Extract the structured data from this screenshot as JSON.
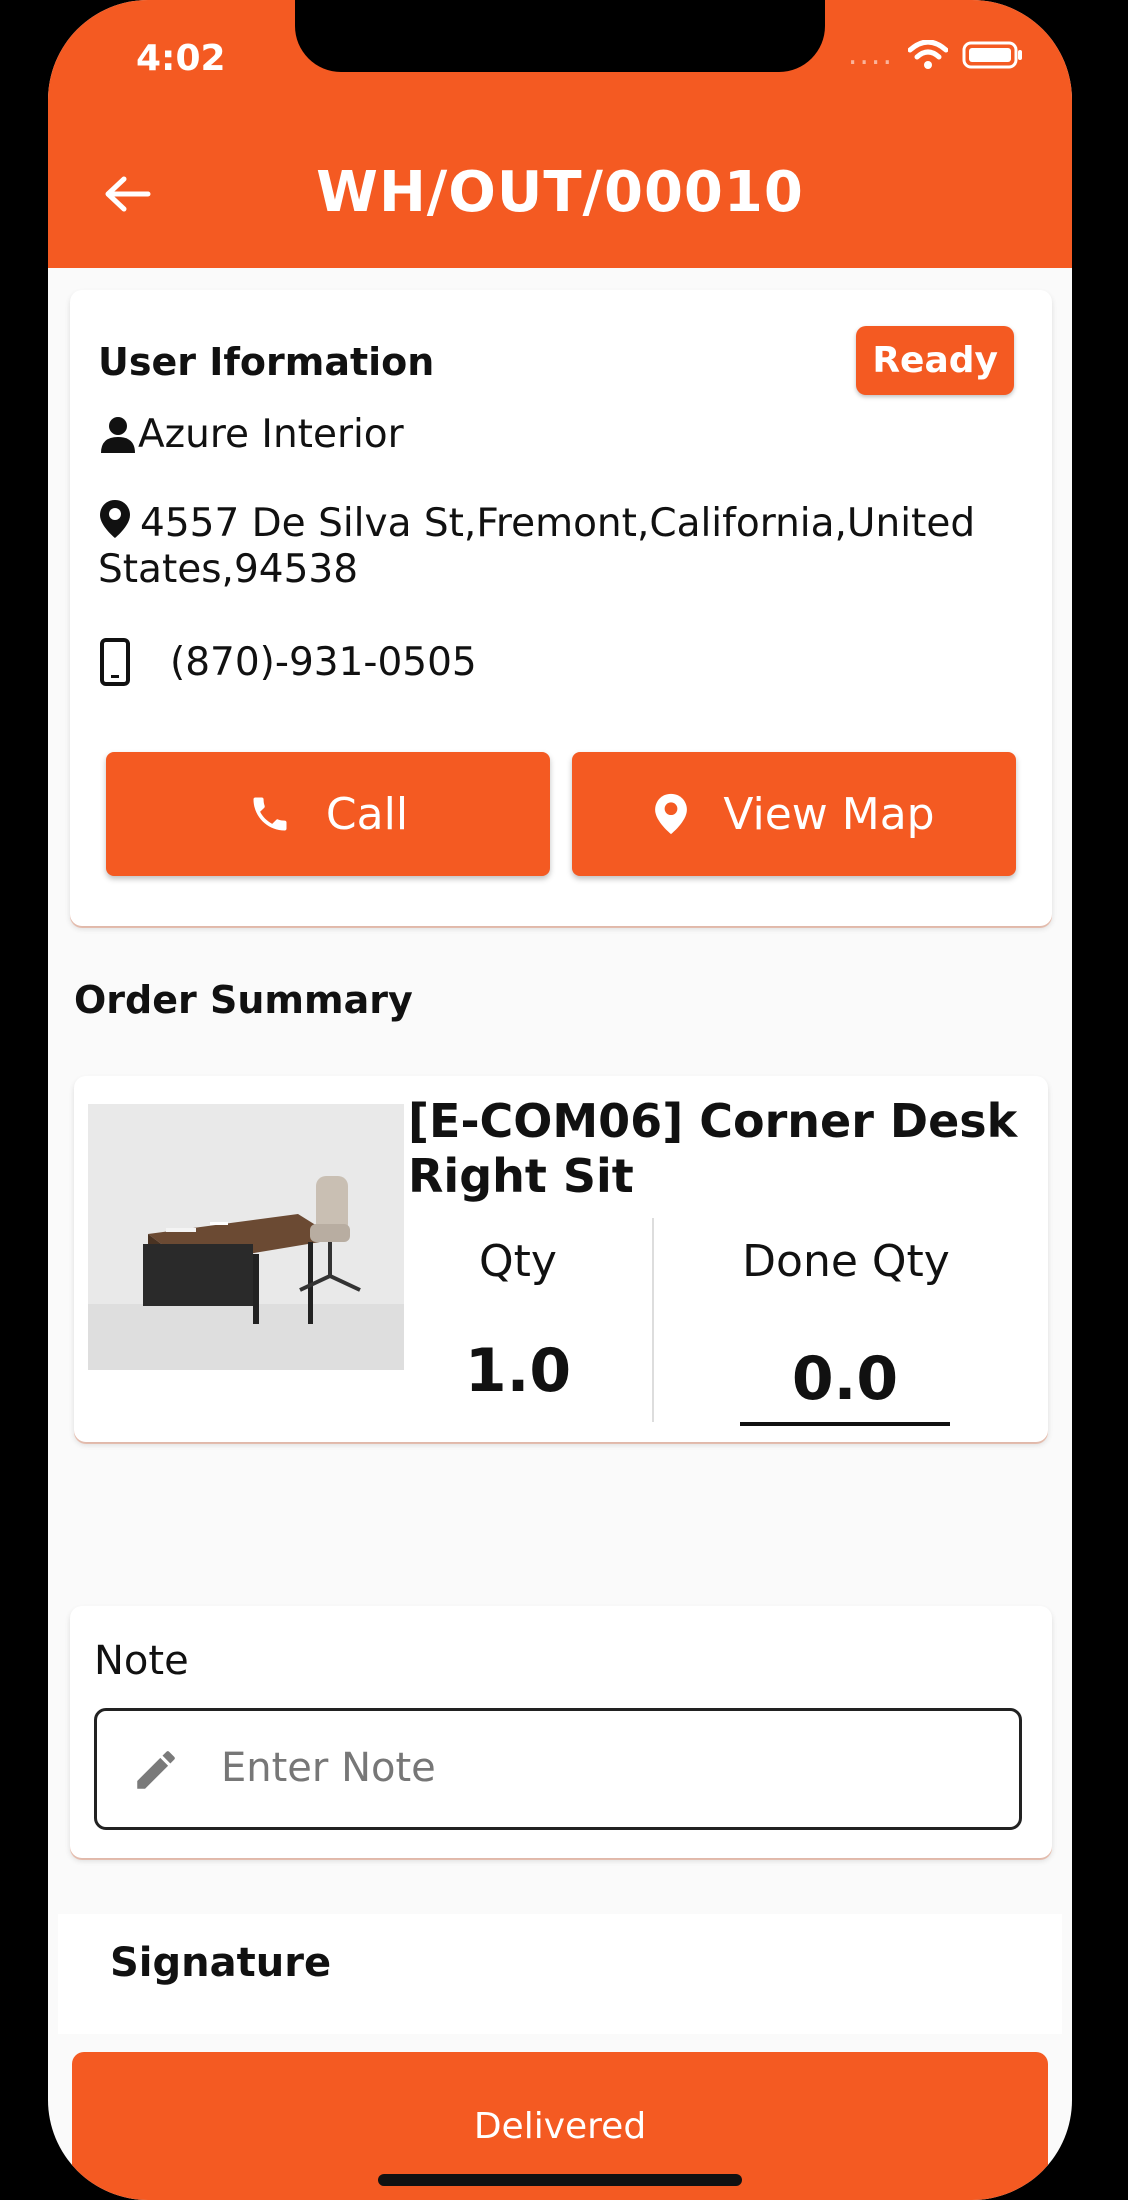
{
  "status_bar": {
    "time": "4:02",
    "signal": "...."
  },
  "header": {
    "title": "WH/OUT/00010"
  },
  "user_card": {
    "title": "User Iformation",
    "status_badge": "Ready",
    "name": "Azure Interior",
    "address": "4557 De Silva St,Fremont,California,United States,94538",
    "phone": "(870)-931-0505",
    "call_label": "Call",
    "map_label": "View Map"
  },
  "order_summary": {
    "title": "Order Summary",
    "items": [
      {
        "name": "[E-COM06] Corner Desk Right Sit",
        "qty_label": "Qty",
        "qty": "1.0",
        "done_qty_label": "Done Qty",
        "done_qty": "0.0"
      }
    ]
  },
  "note": {
    "label": "Note",
    "placeholder": "Enter Note"
  },
  "signature": {
    "title": "Signature"
  },
  "footer": {
    "delivered_label": "Delivered"
  },
  "colors": {
    "accent": "#f45a22",
    "background": "#fafafa"
  }
}
